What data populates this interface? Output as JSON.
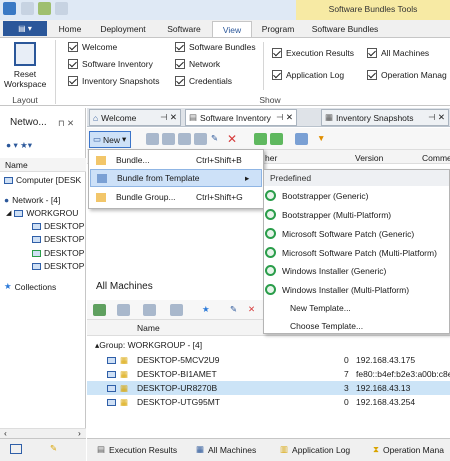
{
  "ribbon": {
    "context_title": "Software Bundles Tools",
    "tabs": [
      {
        "label": "Home"
      },
      {
        "label": "Deployment"
      },
      {
        "label": "Software"
      },
      {
        "label": "View"
      },
      {
        "label": "Program"
      },
      {
        "label": "Software Bundles"
      }
    ],
    "reset_line1": "Reset",
    "reset_line2": "Workspace",
    "layout_group": "Layout",
    "show_group": "Show",
    "checks": [
      "Welcome",
      "Software Inventory",
      "Inventory Snapshots",
      "Software Bundles",
      "Network",
      "Credentials",
      "Execution Results",
      "All Machines",
      "Application Log",
      "Operation Manag"
    ]
  },
  "network": {
    "title": "Netwo...",
    "col": "Name",
    "items": [
      "Computer [DESK",
      "Network - [4]",
      "WORKGROU",
      "DESKTOP",
      "DESKTOP",
      "DESKTOP",
      "DESKTOP",
      "Collections"
    ]
  },
  "doc_tabs": [
    "Welcome",
    "Software Inventory",
    "Inventory Snapshots"
  ],
  "toolbar": {
    "new_label": "New"
  },
  "grid_cols": [
    "her",
    "Version",
    "Comme"
  ],
  "new_menu": [
    {
      "label": "Bundle...",
      "shortcut": "Ctrl+Shift+B"
    },
    {
      "label": "Bundle from Template",
      "shortcut": ""
    },
    {
      "label": "Bundle Group...",
      "shortcut": "Ctrl+Shift+G"
    }
  ],
  "template_menu": {
    "header": "Predefined",
    "items": [
      "Bootstrapper (Generic)",
      "Bootstrapper (Multi-Platform)",
      "Microsoft Software Patch (Generic)",
      "Microsoft Software Patch (Multi-Platform)",
      "Windows Installer (Generic)",
      "Windows Installer (Multi-Platform)"
    ],
    "new": "New Template...",
    "choose": "Choose Template..."
  },
  "all_machines": {
    "title": "All Machines",
    "col": "Name",
    "group": "Group: WORKGROUP - [4]",
    "rows": [
      {
        "name": "DESKTOP-5MCV2U9",
        "n": "0",
        "ip": "192.168.43.175"
      },
      {
        "name": "DESKTOP-BI1AMET",
        "n": "7",
        "ip": "fe80::b4ef:b2e3:a00b:c8e"
      },
      {
        "name": "DESKTOP-UR8270B",
        "n": "3",
        "ip": "192.168.43.13"
      },
      {
        "name": "DESKTOP-UTG95MT",
        "n": "0",
        "ip": "192.168.43.254"
      }
    ]
  },
  "bottom_tabs": [
    "Execution Results",
    "All Machines",
    "Application Log",
    "Operation Mana"
  ],
  "colors": {
    "accent": "#2b579a",
    "selection": "#cce4f7",
    "context": "#f7eaa4"
  }
}
